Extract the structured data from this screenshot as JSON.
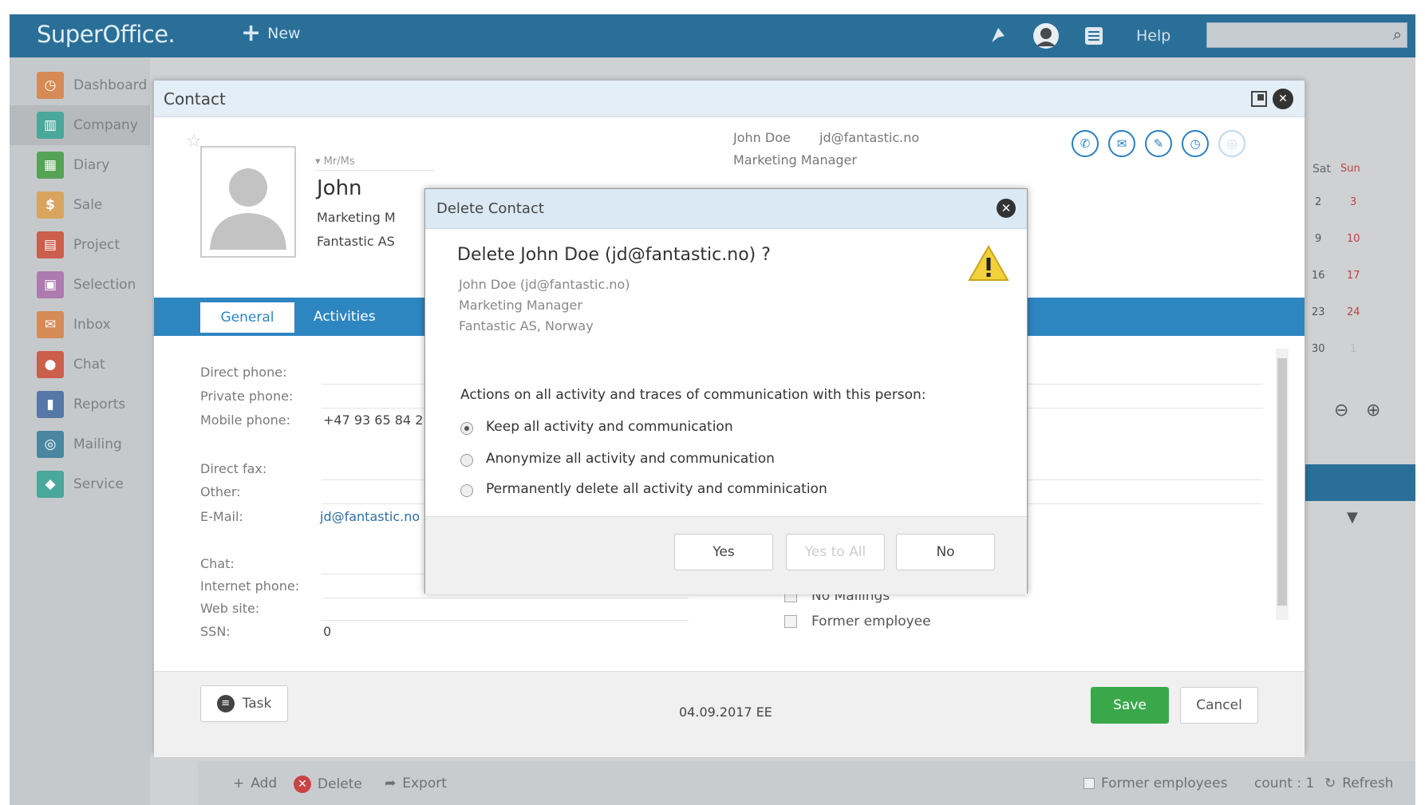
{
  "app": {
    "logo": "SuperOffice.",
    "new_label": "New",
    "help_label": "Help",
    "search_placeholder": ""
  },
  "sidebar": {
    "items": [
      {
        "label": "Dashboard",
        "color": "#e07a2c"
      },
      {
        "label": "Company",
        "color": "#2a9d8f"
      },
      {
        "label": "Diary",
        "color": "#3a9a3a"
      },
      {
        "label": "Sale",
        "color": "#e8a73c"
      },
      {
        "label": "Project",
        "color": "#d9452e"
      },
      {
        "label": "Selection",
        "color": "#b06ab3"
      },
      {
        "label": "Inbox",
        "color": "#e07a2c"
      },
      {
        "label": "Chat",
        "color": "#d9452e"
      },
      {
        "label": "Reports",
        "color": "#3a6fb0"
      },
      {
        "label": "Mailing",
        "color": "#2a7fa0"
      },
      {
        "label": "Service",
        "color": "#2a9d8f"
      }
    ]
  },
  "calendar": {
    "headers": [
      "Sat",
      "Sun"
    ],
    "rows": [
      [
        "2",
        "3"
      ],
      [
        "9",
        "10"
      ],
      [
        "16",
        "17"
      ],
      [
        "23",
        "24"
      ],
      [
        "30",
        "1"
      ]
    ]
  },
  "bottombar": {
    "add": "Add",
    "delete": "Delete",
    "export": "Export",
    "former_employees": "Former employees",
    "count": "count : 1",
    "refresh": "Refresh"
  },
  "contact": {
    "title": "Contact",
    "salutation": "Mr/Ms",
    "first_name": "John",
    "job_title_short": "Marketing M",
    "company": "Fantastic AS",
    "summary_name": "John Doe",
    "summary_email": "jd@fantastic.no",
    "summary_title": "Marketing Manager",
    "tabs": {
      "general": "General",
      "activities": "Activities"
    },
    "fields": {
      "direct_phone": "Direct phone:",
      "private_phone": "Private phone:",
      "mobile_phone": "Mobile phone:",
      "mobile_value": "+47 93 65 84 2",
      "direct_fax": "Direct fax:",
      "other": "Other:",
      "email": "E-Mail:",
      "email_value": "jd@fantastic.no",
      "chat": "Chat:",
      "internet_phone": "Internet phone:",
      "web_site": "Web site:",
      "ssn": "SSN:",
      "ssn_value": "0"
    },
    "checkboxes": {
      "no_mailings": "No Mailings",
      "former_employee": "Former employee"
    },
    "footer": {
      "task": "Task",
      "date": "04.09.2017 EE",
      "save": "Save",
      "cancel": "Cancel"
    }
  },
  "dialog": {
    "title": "Delete Contact",
    "question": "Delete John Doe (jd@fantastic.no) ?",
    "info": [
      "John Doe (jd@fantastic.no)",
      "Marketing Manager",
      "Fantastic AS, Norway"
    ],
    "actions_label": "Actions on all activity and traces of communication with this person:",
    "options": [
      "Keep all activity and communication",
      "Anonymize all activity and communication",
      "Permanently delete all activity and comminication"
    ],
    "selected_option": 0,
    "buttons": {
      "yes": "Yes",
      "yes_to_all": "Yes to All",
      "no": "No"
    }
  }
}
